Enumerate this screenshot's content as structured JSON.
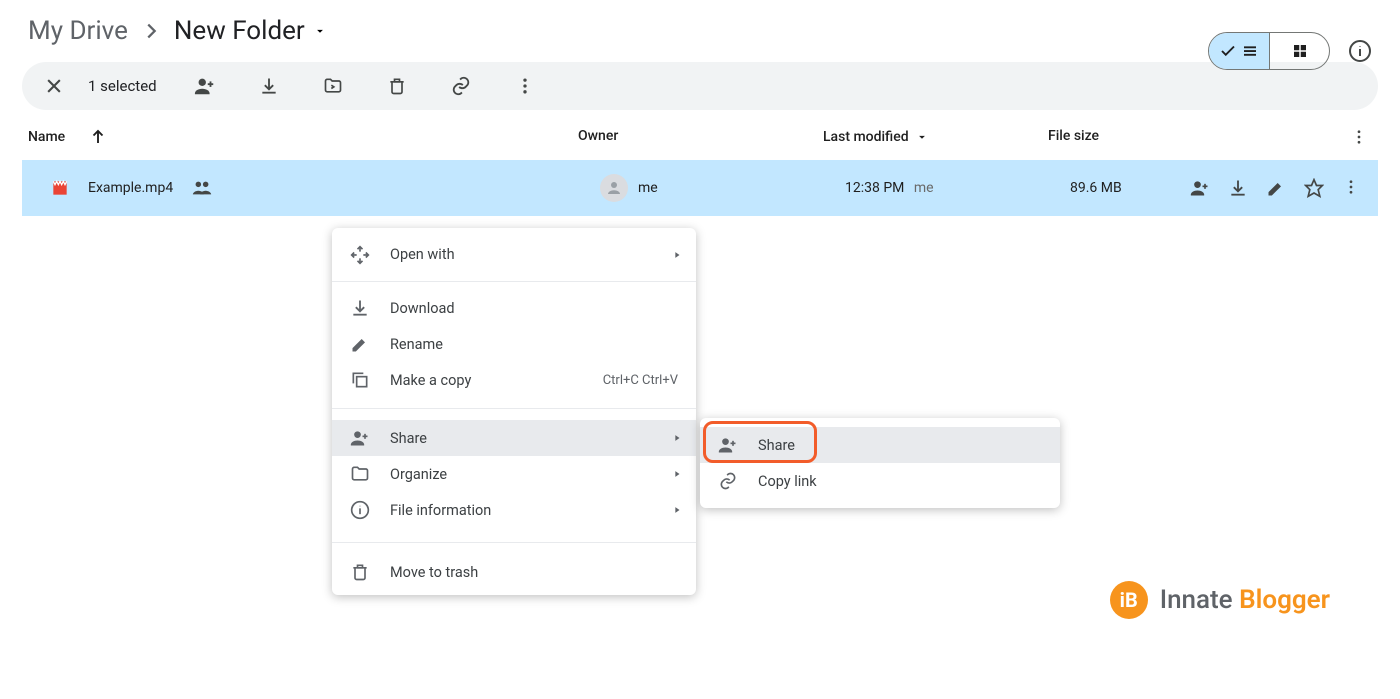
{
  "breadcrumb": {
    "root": "My Drive",
    "folder": "New Folder"
  },
  "selection": {
    "count_label": "1 selected"
  },
  "columns": {
    "name": "Name",
    "owner": "Owner",
    "modified": "Last modified",
    "size": "File size"
  },
  "row": {
    "filename": "Example.mp4",
    "owner": "me",
    "modified_time": "12:38 PM",
    "modified_by": "me",
    "size": "89.6 MB"
  },
  "context_menu": {
    "open_with": "Open with",
    "download": "Download",
    "rename": "Rename",
    "make_copy": "Make a copy",
    "make_copy_kbd": "Ctrl+C Ctrl+V",
    "share": "Share",
    "organize": "Organize",
    "file_info": "File information",
    "trash": "Move to trash"
  },
  "share_submenu": {
    "share": "Share",
    "copy_link": "Copy link"
  },
  "watermark": {
    "brand1": "Innate",
    "brand2": "Blogger"
  }
}
